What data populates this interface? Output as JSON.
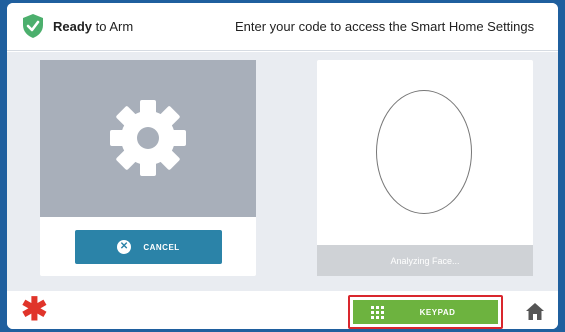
{
  "header": {
    "status_bold": "Ready",
    "status_rest": " to Arm",
    "prompt": "Enter your code to access the Smart Home Settings"
  },
  "camera": {
    "cancel_label": "CANCEL"
  },
  "face": {
    "status_label": "Analyzing Face..."
  },
  "footer": {
    "keypad_label": "KEYPAD"
  },
  "colors": {
    "frame_background": "#1f5f9e",
    "shield_green": "#4caf6d",
    "cancel_blue": "#2b83a8",
    "keypad_green": "#6db33f",
    "highlight_red": "#d9262d",
    "asterisk_red": "#e0342a"
  },
  "icons": [
    "shield-check-icon",
    "gear-icon",
    "close-icon",
    "keypad-grid-icon",
    "home-icon",
    "asterisk-icon"
  ]
}
